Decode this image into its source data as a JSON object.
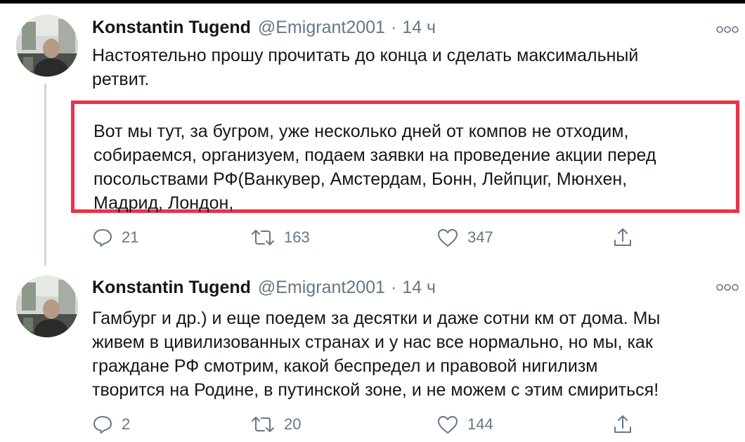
{
  "tweets": [
    {
      "name": "Konstantin Tugend",
      "handle": "@Emigrant2001",
      "separator": "·",
      "time": "14 ч",
      "text": "Настоятельно прошу прочитать до конца и сделать максимальный\nретвит.",
      "highlighted_text": "Вот мы тут, за бугром, уже несколько дней от компов не отходим,\nсобираемся, организуем, подаем заявки на проведение акции перед\nпосольствами РФ(Ванкувер, Амстердам, Бонн, Лейпциг, Мюнхен,\nМадрид, Лондон,",
      "replies": "21",
      "retweets": "163",
      "likes": "347"
    },
    {
      "name": "Konstantin Tugend",
      "handle": "@Emigrant2001",
      "separator": "·",
      "time": "14 ч",
      "text": "Гамбург и др.) и еще поедем за десятки и даже сотни км от дома. Мы\nживем в цивилизованных странах и у нас все нормально, но мы, как\nграждане РФ смотрим, какой беспредел и правовой нигилизм\nтворится на Родине, в путинской зоне, и не можем с этим смириться!",
      "replies": "2",
      "retweets": "20",
      "likes": "144"
    }
  ],
  "icons": {
    "reply": "reply-icon",
    "retweet": "retweet-icon",
    "like": "heart-icon",
    "share": "share-icon",
    "more": "more-icon"
  },
  "colors": {
    "highlight_border": "#e8334a",
    "secondary_text": "#657786",
    "primary_text": "#14171a"
  }
}
